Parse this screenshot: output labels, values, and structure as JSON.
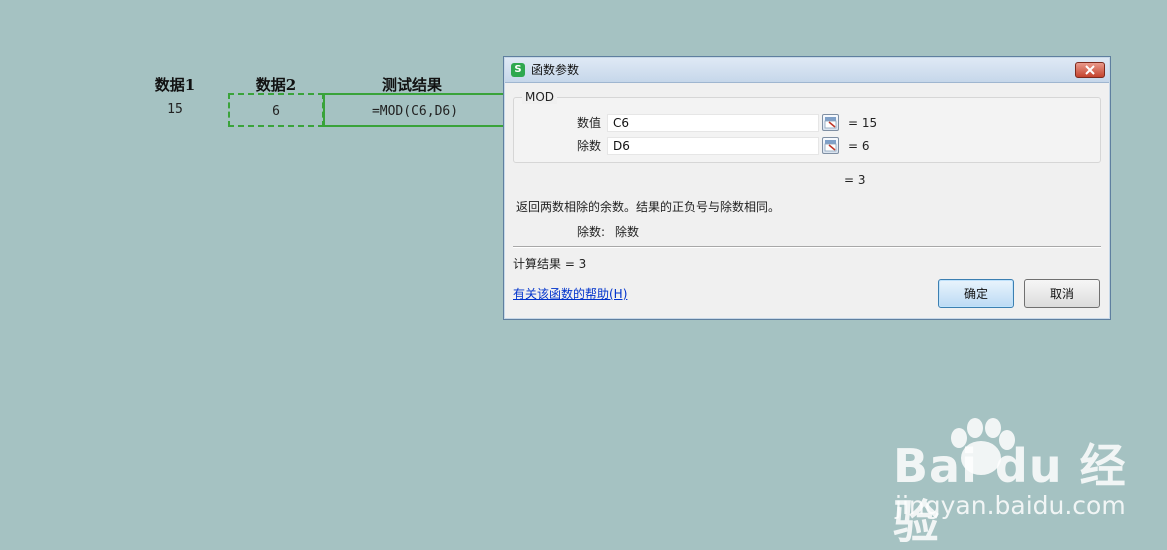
{
  "sheet": {
    "headers": [
      "数据1",
      "数据2",
      "测试结果"
    ],
    "row": [
      "15",
      "6",
      "=MOD(C6,D6)"
    ]
  },
  "dialog": {
    "title": "函数参数",
    "function_name": "MOD",
    "args": [
      {
        "label": "数值",
        "value": "C6",
        "result": "= 15"
      },
      {
        "label": "除数",
        "value": "D6",
        "result": "= 6"
      }
    ],
    "formula_result": "= 3",
    "description": "返回两数相除的余数。结果的正负号与除数相同。",
    "param_help_label": "除数:",
    "param_help_text": "除数",
    "calc_result": "计算结果 = 3",
    "help_link": "有关该函数的帮助(H)",
    "ok_label": "确定",
    "cancel_label": "取消",
    "app_icon_letter": "S"
  },
  "watermark": {
    "brand": "Bai du 经验",
    "url": "jingyan.baidu.com"
  },
  "colors": {
    "background": "#a5c2c2",
    "selection_green": "#3aa33a",
    "link_blue": "#0033cc"
  }
}
